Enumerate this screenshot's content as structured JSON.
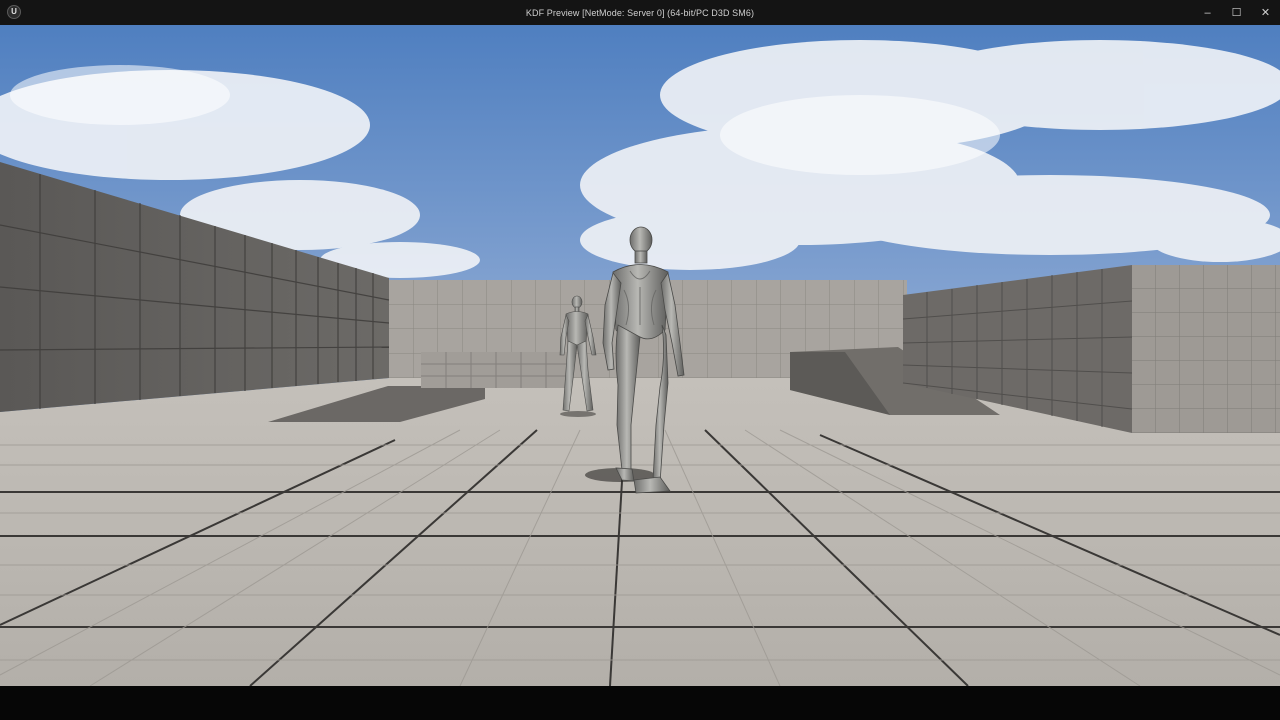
{
  "window": {
    "logo_glyph": "U",
    "title": "KDF Preview [NetMode: Server 0]  (64-bit/PC D3D SM6)",
    "controls": {
      "minimize_glyph": "–",
      "maximize_glyph": "☐",
      "close_glyph": "✕"
    }
  },
  "scene": {
    "sky_color": "#5f89c4",
    "floor_color": "#b8b4ae",
    "wall_color": "#8f8c88",
    "character_color": "#9c9c98"
  }
}
